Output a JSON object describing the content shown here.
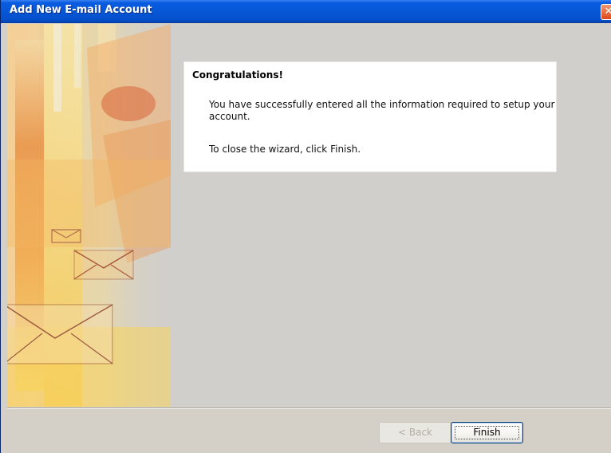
{
  "window": {
    "title": "Add New E-mail Account",
    "close_icon": "close-icon"
  },
  "panel": {
    "title": "Congratulations!",
    "message": "You have successfully entered all the information required to setup your account.",
    "hint": "To close the wizard, click Finish."
  },
  "buttons": {
    "back_label": "< Back",
    "back_enabled": false,
    "finish_label": "Finish"
  },
  "colors": {
    "titlebar": "#0757d8",
    "accent_orange": "#e8813a",
    "accent_yellow": "#f8d96a",
    "dialog_bg": "#d1cfcb"
  }
}
